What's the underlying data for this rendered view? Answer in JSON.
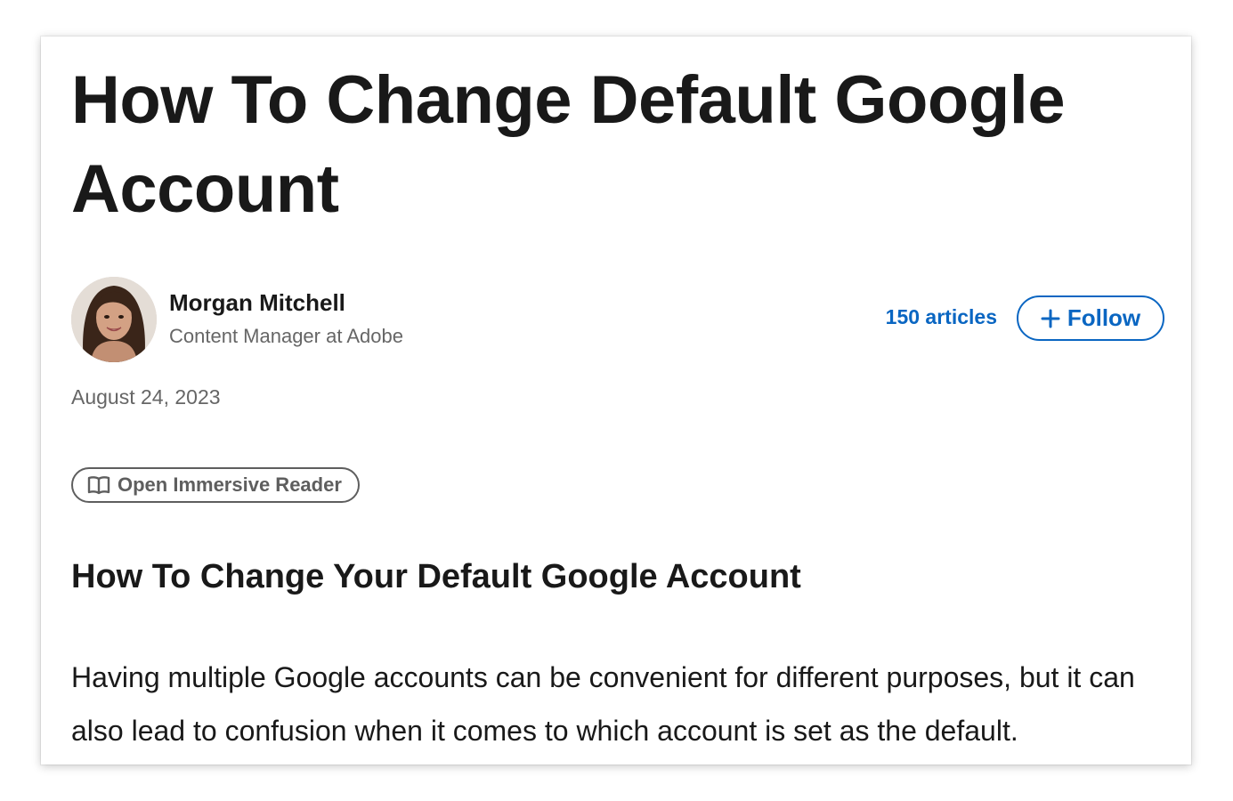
{
  "article": {
    "title": "How To Change Default Google Account",
    "date": "August 24, 2023",
    "subheading": "How To Change Your Default Google Account",
    "body": "Having multiple Google accounts can be convenient for different purposes, but it can also lead to confusion when it comes to which account is set as the default."
  },
  "author": {
    "name": "Morgan Mitchell",
    "role": "Content Manager at Adobe",
    "articles_label": "150 articles",
    "follow_label": "Follow"
  },
  "reader": {
    "label": "Open Immersive Reader"
  },
  "icons": {
    "follow": "plus-icon",
    "reader": "book-icon"
  },
  "colors": {
    "accent": "#0a66c2",
    "text": "#191919",
    "muted": "#666666"
  }
}
